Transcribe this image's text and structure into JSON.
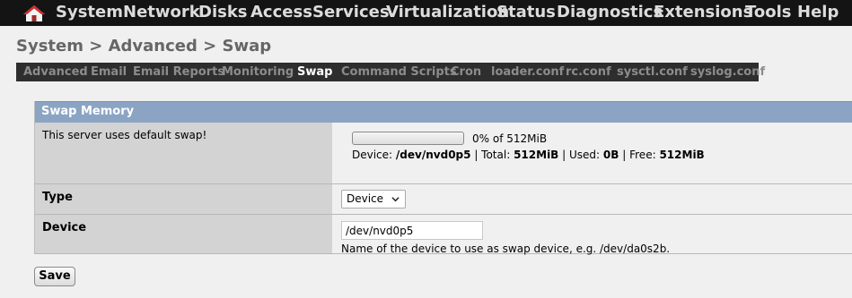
{
  "nav": {
    "items": [
      "System",
      "Network",
      "Disks",
      "Access",
      "Services",
      "Virtualization",
      "Status",
      "Diagnostics",
      "Extensions",
      "Tools",
      "Help"
    ]
  },
  "breadcrumb": "System > Advanced > Swap",
  "tabs": [
    "Advanced",
    "Email",
    "Email Reports",
    "Monitoring",
    "Swap",
    "Command Scripts",
    "Cron",
    "loader.conf",
    "rc.conf",
    "sysctl.conf",
    "syslog.conf"
  ],
  "active_tab": "Swap",
  "panel": {
    "title": "Swap Memory",
    "info_label": "This server uses default swap!",
    "usage": {
      "percent": 0,
      "percent_text": "0% of 512MiB",
      "device_label": "Device:",
      "device": "/dev/nvd0p5",
      "total_label": "| Total:",
      "total": "512MiB",
      "used_label": "| Used:",
      "used": "0B",
      "free_label": "| Free:",
      "free": "512MiB"
    },
    "type_label": "Type",
    "type_value": "Device",
    "device_label": "Device",
    "device_value": "/dev/nvd0p5",
    "device_hint": "Name of the device to use as swap device, e.g. /dev/da0s2b."
  },
  "save_label": "Save",
  "colors": {
    "nav_bg": "#141414",
    "panel_header": "#8ba4c4",
    "label_bg": "#d3d3d3",
    "home_roof": "#d42b2b"
  }
}
